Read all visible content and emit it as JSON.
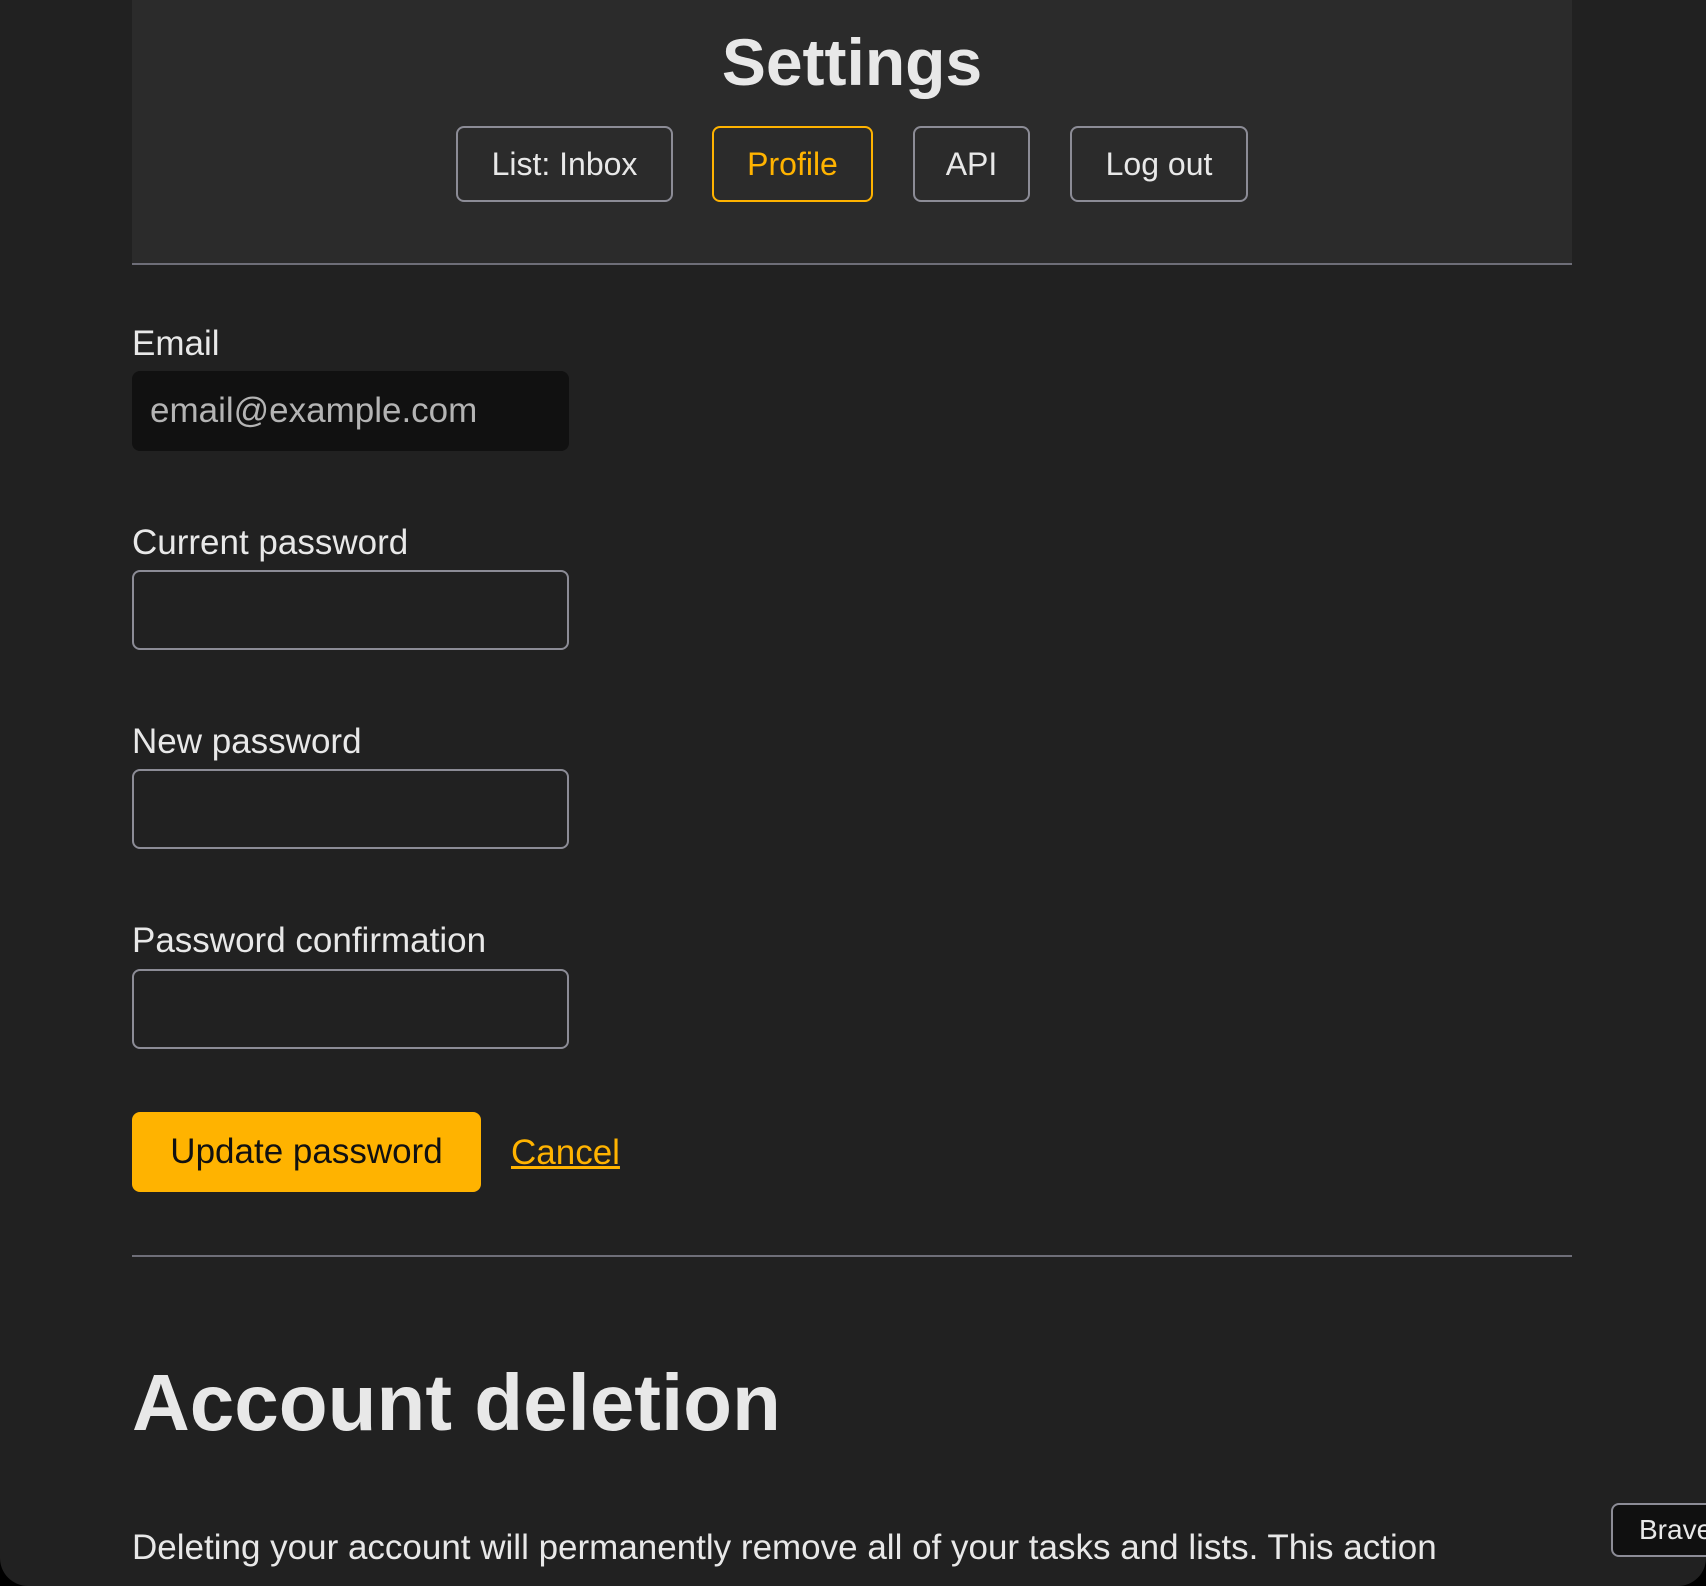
{
  "header": {
    "title": "Settings",
    "nav": [
      {
        "label": "List: Inbox",
        "active": false
      },
      {
        "label": "Profile",
        "active": true
      },
      {
        "label": "API",
        "active": false
      },
      {
        "label": "Log out",
        "active": false
      }
    ]
  },
  "profile_form": {
    "email": {
      "label": "Email",
      "value": "email@example.com"
    },
    "current_password": {
      "label": "Current password",
      "value": ""
    },
    "new_password": {
      "label": "New password",
      "value": ""
    },
    "password_confirmation": {
      "label": "Password confirmation",
      "value": ""
    },
    "submit_label": "Update password",
    "cancel_label": "Cancel"
  },
  "account_deletion": {
    "title": "Account deletion",
    "description": "Deleting your account will permanently remove all of your tasks and lists. This action"
  },
  "floating_badge": {
    "label": "Brave"
  },
  "colors": {
    "accent": "#ffb300",
    "background": "#212121",
    "header_background": "#2b2b2b",
    "border": "#8c8c96",
    "text": "#e8e8e8"
  }
}
